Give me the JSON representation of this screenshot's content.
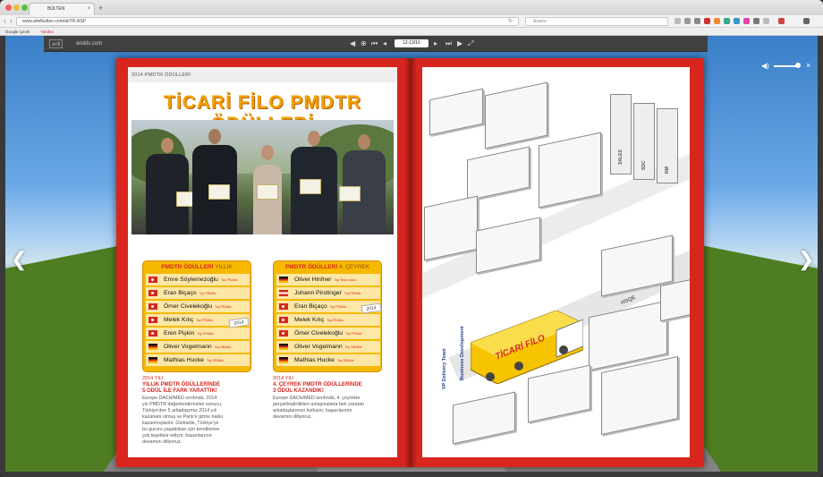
{
  "browser": {
    "tab_title": "BÜLTEN",
    "tab_close": "×",
    "new_tab": "+",
    "url": "www.ahelbulten.com/ahTR.ASP",
    "search_placeholder": "Arama",
    "bookmarks": [
      "Google Çeviri",
      "Yandex"
    ]
  },
  "viewer": {
    "logo": "anll",
    "site": "andds.com",
    "page_indicator": "12-13/16",
    "prev_arrow": "❮",
    "next_arrow": "❯",
    "close": "×"
  },
  "left_page": {
    "section": "2014 PMDTR ÖDÜLLERİ",
    "title": "TİCARİ FİLO PMDTR ÖDÜLLERİ",
    "page_number": "12",
    "box1": {
      "caption_main": "PMDTR ÖDÜLLERİ",
      "caption_sub": "YILLIK",
      "rows": [
        {
          "flag": "tr",
          "name": "Emre Söylemezoğlu",
          "note": "Top PRAMs"
        },
        {
          "flag": "tr",
          "name": "Eran Biçaço",
          "note": "Top PRAMs"
        },
        {
          "flag": "tr",
          "name": "Ömer Civelekoğlu",
          "note": "Top PRAMs"
        },
        {
          "flag": "tr",
          "name": "Melek Kılıç",
          "note": "Top PRAMs"
        },
        {
          "flag": "tr",
          "name": "Eren Pişkin",
          "note": "Top PRAMs"
        },
        {
          "flag": "de",
          "name": "Oliver Vogelmann",
          "note": "Top OBAMs"
        },
        {
          "flag": "de",
          "name": "Mathias Hucke",
          "note": "Top OBAMs"
        }
      ],
      "stamp": "2014",
      "year_label": "2014 YILI",
      "headline_1": "YILLIK PMDTR ÖDÜLLERİNDE",
      "headline_2": "5 ÖDÜL İLE FARK YARATTIK!",
      "body": [
        "Europe DACH/MED sınıfında, 2014",
        "yılı PMDTR değerlendirmeleri sonucu,",
        "Türkiye'den 5 arkadaşımız 2014 yılı",
        "kazananı olmuş ve Paris'e gitme hakkı",
        "kazanmışlardır. Globalde, Türkiye'ye",
        "bu gururu yaşattıkları için kendilerine",
        "çok teşekkür ediyor, başarılarının",
        "devamını diliyoruz."
      ]
    },
    "box2": {
      "caption_main": "PMDTR ÖDÜLLERİ",
      "caption_sub": "4. ÇEYREK",
      "rows": [
        {
          "flag": "de",
          "name": "Oliver Hinfner",
          "note": "Top Team Lead"
        },
        {
          "flag": "at",
          "name": "Johann Pirstinger",
          "note": "Top PRAMs"
        },
        {
          "flag": "tr",
          "name": "Eran Biçaço",
          "note": "Top PRAMs"
        },
        {
          "flag": "tr",
          "name": "Melek Kılıç",
          "note": "Top PRAMs"
        },
        {
          "flag": "tr",
          "name": "Ömer Civelekoğlu",
          "note": "Top PRAMs"
        },
        {
          "flag": "de",
          "name": "Oliver Vogelmann",
          "note": "Top OBAMs"
        },
        {
          "flag": "de",
          "name": "Mathias Hucke",
          "note": "Top OBAMs"
        }
      ],
      "stamp": "2014",
      "year_label": "2014 YILI",
      "headline_1": "4. ÇEYREK PMDTR ÖDÜLLERİNDE",
      "headline_2": "3 ÖDÜL KAZANDIK!",
      "body": [
        "Europe DACH/MED sınıfında, 4. çeyrekte",
        "gerçekleştirdikleri anlaşmalarla fark yaratan",
        "arkadaşlarımızı kutluyor, başarılarının",
        "devamını diliyoruz."
      ]
    }
  },
  "right_page": {
    "page_number": "13",
    "truck_label": "TİCARİ FİLO",
    "binder_labels": [
      "SALES",
      "SDC",
      "NM"
    ],
    "side_labels": [
      "HSQE",
      "VP Delivery Team",
      "Business Development"
    ]
  }
}
